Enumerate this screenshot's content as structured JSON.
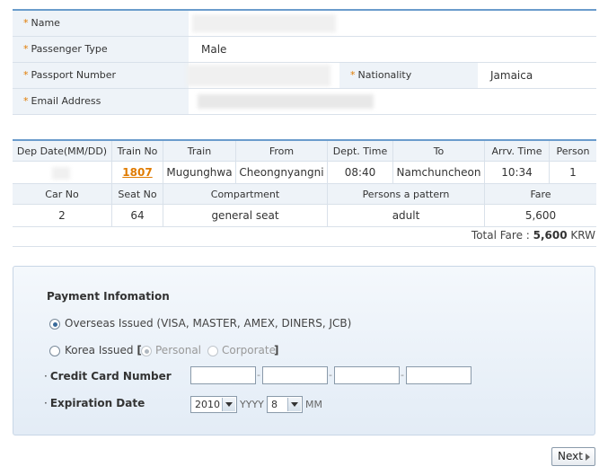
{
  "passenger": {
    "name_label": "Name",
    "type_label": "Passenger Type",
    "type_value": "Male",
    "passport_label": "Passport Number",
    "nationality_label": "Nationality",
    "nationality_value": "Jamaica",
    "email_label": "Email Address"
  },
  "train": {
    "headers": [
      "Dep Date(MM/DD)",
      "Train No",
      "Train",
      "From",
      "Dept. Time",
      "To",
      "Arrv. Time",
      "Person"
    ],
    "row": {
      "train_no": "1807",
      "train": "Mugunghwa",
      "from": "Cheongnyangni",
      "dept_time": "08:40",
      "to": "Namchuncheon",
      "arrv_time": "10:34",
      "person": "1"
    },
    "headers2": [
      "Car No",
      "Seat No",
      "Compartment",
      "Persons a pattern",
      "Fare"
    ],
    "row2": {
      "car_no": "2",
      "seat_no": "64",
      "compartment": "general seat",
      "persons_pattern": "adult",
      "fare": "5,600"
    },
    "total_label": "Total Fare : ",
    "total_value": "5,600",
    "total_currency": " KRW"
  },
  "payment": {
    "title": "Payment Infomation",
    "overseas_label": "Overseas Issued (VISA, MASTER, AMEX, DINERS, JCB)",
    "korea_label": "Korea Issued",
    "bracket_open": "[",
    "personal_label": "Personal",
    "corporate_label": "Corporate",
    "bracket_close": "]",
    "card_number_label": "Credit Card Number",
    "expiration_label": "Expiration Date",
    "dot": "·",
    "dash": "-",
    "year_value": "2010",
    "year_unit": "YYYY",
    "month_value": "8",
    "month_unit": "MM"
  },
  "next_label": "Next"
}
